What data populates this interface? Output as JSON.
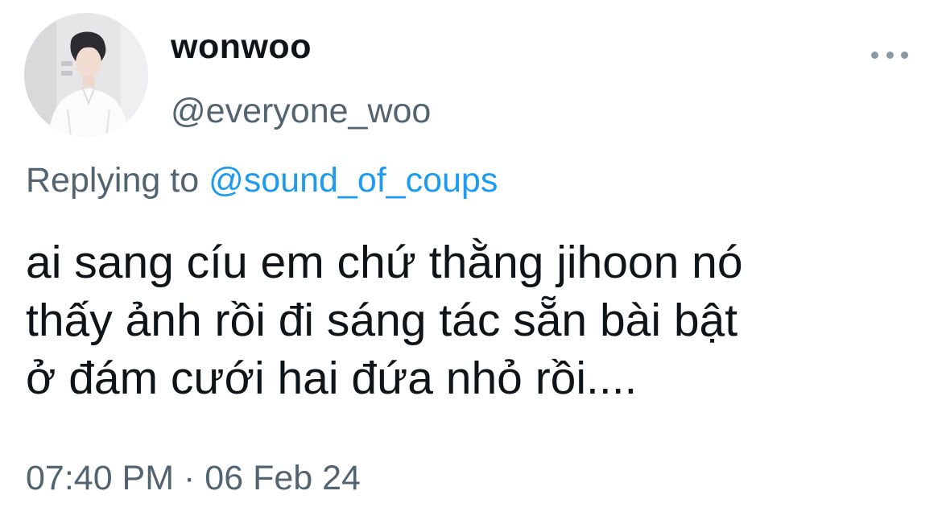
{
  "author": {
    "display_name": "wonwoo",
    "handle": "@everyone_woo",
    "avatar_icon": "profile-photo"
  },
  "more_icon": "more-horizontal-icon",
  "reply": {
    "prefix": "Replying to",
    "mention": "@sound_of_coups"
  },
  "tweet": {
    "lines": [
      "ai sang cíu em chứ thằng jihoon nó",
      "thấy ảnh rồi đi sáng tác sẵn bài bật",
      "ở đám cưới hai đứa nhỏ rồi...."
    ]
  },
  "meta": {
    "time": "07:40 PM",
    "separator": "·",
    "date": "06 Feb 24"
  },
  "colors": {
    "text": "#0f1419",
    "secondary": "#536471",
    "link": "#1d9bf0"
  }
}
